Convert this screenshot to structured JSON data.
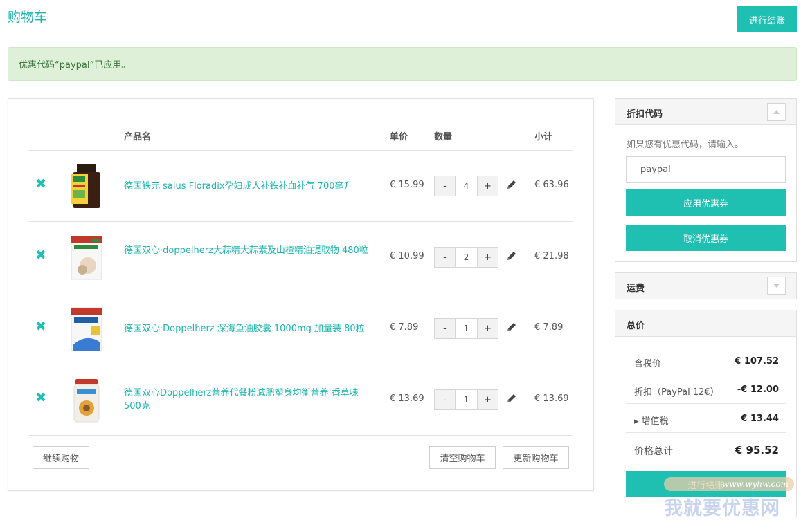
{
  "page": {
    "title": "购物车",
    "checkout_label": "进行结账"
  },
  "alert": {
    "message": "优惠代码“paypal”已应用。"
  },
  "cart": {
    "headers": {
      "product": "产品名",
      "price": "单价",
      "qty": "数量",
      "subtotal": "小计"
    },
    "items": [
      {
        "name": "德国铁元 salus Floradix孕妇成人补铁补血补气 700毫升",
        "price": "€ 15.99",
        "qty": "4",
        "subtotal": "€ 63.96"
      },
      {
        "name": "德国双心·doppelherz大蒜精大蒜素及山楂精油提取物 480粒",
        "price": "€ 10.99",
        "qty": "2",
        "subtotal": "€ 21.98"
      },
      {
        "name": "德国双心·Doppelherz 深海鱼油胶囊 1000mg 加量装 80粒",
        "price": "€ 7.89",
        "qty": "1",
        "subtotal": "€ 7.89"
      },
      {
        "name": "德国双心Doppelherz营养代餐粉减肥塑身均衡营养 香草味 500克",
        "price": "€ 13.69",
        "qty": "1",
        "subtotal": "€ 13.69"
      }
    ],
    "qty_minus": "-",
    "qty_plus": "+",
    "continue_label": "继续购物",
    "clear_label": "清空购物车",
    "update_label": "更新购物车"
  },
  "coupon": {
    "title": "折扣代码",
    "hint": "如果您有优惠代码，请输入。",
    "value": "paypal",
    "apply_label": "应用优惠券",
    "cancel_label": "取消优惠券"
  },
  "shipping": {
    "title": "运费"
  },
  "totals": {
    "title": "总价",
    "rows": [
      {
        "label": "含税价",
        "value": "€ 107.52"
      },
      {
        "label": "折扣（PayPal 12€）",
        "value": "-€ 12.00"
      },
      {
        "label": "▸ 增值税",
        "value": "€ 13.44"
      },
      {
        "label": "价格总计",
        "value": "€ 95.52"
      }
    ],
    "checkout_label": "进行结账"
  },
  "watermark": {
    "url": "www.wyhw.com",
    "text": "我就要优惠网"
  },
  "colors": {
    "accent": "#1fbfb2",
    "link": "#1ab5ac",
    "alert_bg": "#dff0d8"
  },
  "icons": {
    "remove": "close-x-icon",
    "edit": "pencil-icon",
    "collapse": "chevron-up-icon",
    "expand": "chevron-down-icon"
  }
}
